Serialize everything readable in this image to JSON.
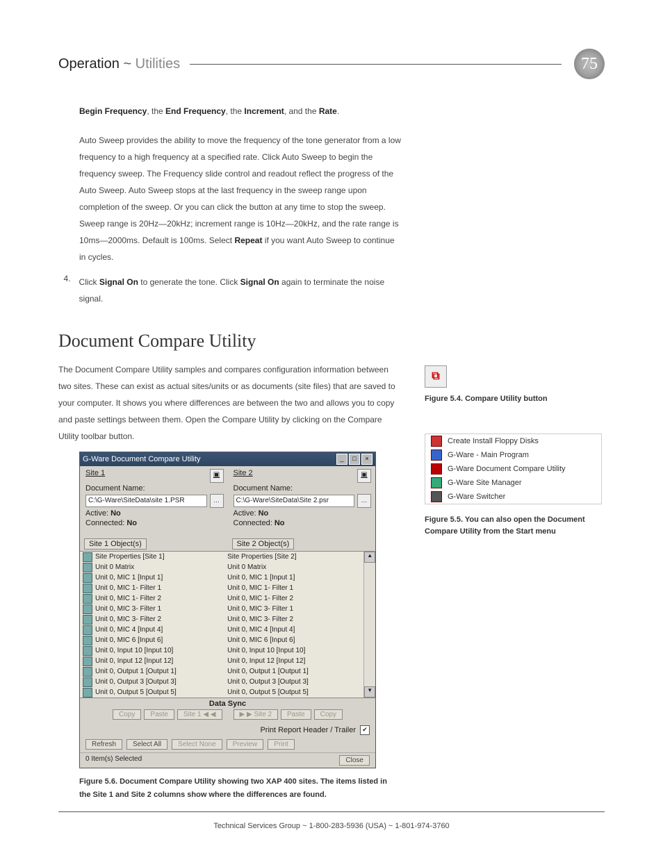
{
  "page_number": "75",
  "header": {
    "op": "Operation",
    "sep": " ~ ",
    "ut": "Utilities"
  },
  "intro_line": {
    "b1": "Begin Frequency",
    "t1": ", the ",
    "b2": "End Frequency",
    "t2": ", the ",
    "b3": "Increment",
    "t3": ", and the ",
    "b4": "Rate",
    "t4": "."
  },
  "para1": "Auto Sweep provides the ability to move the frequency of the tone generator from a low frequency to a high frequency at a specified rate. Click Auto Sweep to begin the frequency sweep. The Frequency slide control and readout reflect the progress of the Auto Sweep. Auto Sweep stops at the last frequency in the sweep range upon completion of the sweep. Or you can click the button at any time to stop the sweep. Sweep range is 20Hz—20kHz; increment range is 10Hz—20kHz, and the rate range is 10ms—2000ms. Default is 100ms. Select ",
  "para1_bold": "Repeat",
  "para1_tail": " if you want Auto Sweep to continue in cycles.",
  "step4": {
    "num": "4.",
    "lead": "Click ",
    "b1": "Signal On",
    "mid": " to generate the tone. Click ",
    "b2": "Signal On",
    "tail": " again to terminate the noise signal."
  },
  "section_heading": "Document Compare Utility",
  "para2": "The Document Compare Utility samples and compares configuration information between two sites. These can exist as actual sites/units or as documents (site files) that are saved to your computer. It shows you where differences are between the two and allows you to copy and paste settings between them. Open the Compare Utility by clicking on the Compare Utility toolbar button.",
  "compare_icon_glyph": "⧉",
  "fig54": "Figure 5.4. Compare Utility button",
  "start_menu_items": [
    "Create Install Floppy Disks",
    "G-Ware - Main Program",
    "G-Ware Document Compare Utility",
    "G-Ware Site Manager",
    "G-Ware Switcher"
  ],
  "fig55": "Figure 5.5. You can also open the Document Compare Utility from the Start menu",
  "dcw": {
    "title": "G-Ware Document Compare Utility",
    "min": "_",
    "max": "□",
    "close": "×",
    "site1": {
      "hdr": "Site 1",
      "lbl": "Document Name:",
      "path": "C:\\G-Ware\\SiteData\\site 1.PSR",
      "active": "Active:",
      "active_v": "No",
      "connected": "Connected:",
      "connected_v": "No",
      "obj_btn": "Site 1 Object(s)"
    },
    "site2": {
      "hdr": "Site 2",
      "lbl": "Document Name:",
      "path": "C:\\G-Ware\\SiteData\\Site 2.psr",
      "active": "Active:",
      "active_v": "No",
      "connected": "Connected:",
      "connected_v": "No",
      "obj_btn": "Site 2 Object(s)"
    },
    "rows1": [
      "Site Properties [Site 1]",
      "Unit 0 Matrix",
      "Unit 0, MIC 1 [Input 1]",
      "Unit 0, MIC 1- Filter 1",
      "Unit 0, MIC 1- Filter 2",
      "Unit 0, MIC 3- Filter 1",
      "Unit 0, MIC 3- Filter 2",
      "Unit 0, MIC 4 [Input 4]",
      "Unit 0, MIC 6 [Input 6]",
      "Unit 0, Input 10 [Input 10]",
      "Unit 0, Input 12 [Input 12]",
      "Unit 0, Output 1 [Output 1]",
      "Unit 0, Output 3 [Output 3]",
      "Unit 0, Output 5 [Output 5]"
    ],
    "rows2": [
      "Site Properties [Site 2]",
      "Unit 0 Matrix",
      "Unit 0, MIC 1 [Input 1]",
      "Unit 0, MIC 1- Filter 1",
      "Unit 0, MIC 1- Filter 2",
      "Unit 0, MIC 3- Filter 1",
      "Unit 0, MIC 3- Filter 2",
      "Unit 0, MIC 4 [Input 4]",
      "Unit 0, MIC 6 [Input 6]",
      "Unit 0, Input 10 [Input 10]",
      "Unit 0, Input 12 [Input 12]",
      "Unit 0, Output 1 [Output 1]",
      "Unit 0, Output 3 [Output 3]",
      "Unit 0, Output 5 [Output 5]"
    ],
    "datasync": "Data Sync",
    "ds_btns_left": [
      "Copy",
      "Paste",
      "Site 1  ◀  ◀"
    ],
    "ds_btns_right": [
      "▶  ▶  Site 2",
      "Paste",
      "Copy"
    ],
    "print_label": "Print Report Header / Trailer",
    "print_checked": "✔",
    "refresh": "Refresh",
    "select_all": "Select All",
    "select_none": "Select None",
    "preview": "Preview",
    "print": "Print",
    "status": "0 Item(s) Selected",
    "close_btn": "Close"
  },
  "fig56": "Figure 5.6. Document Compare Utility showing two XAP 400 sites. The items listed in the Site 1 and Site 2 columns show where the differences are found.",
  "footer": "Technical Services Group ~ 1-800-283-5936 (USA) ~ 1-801-974-3760"
}
